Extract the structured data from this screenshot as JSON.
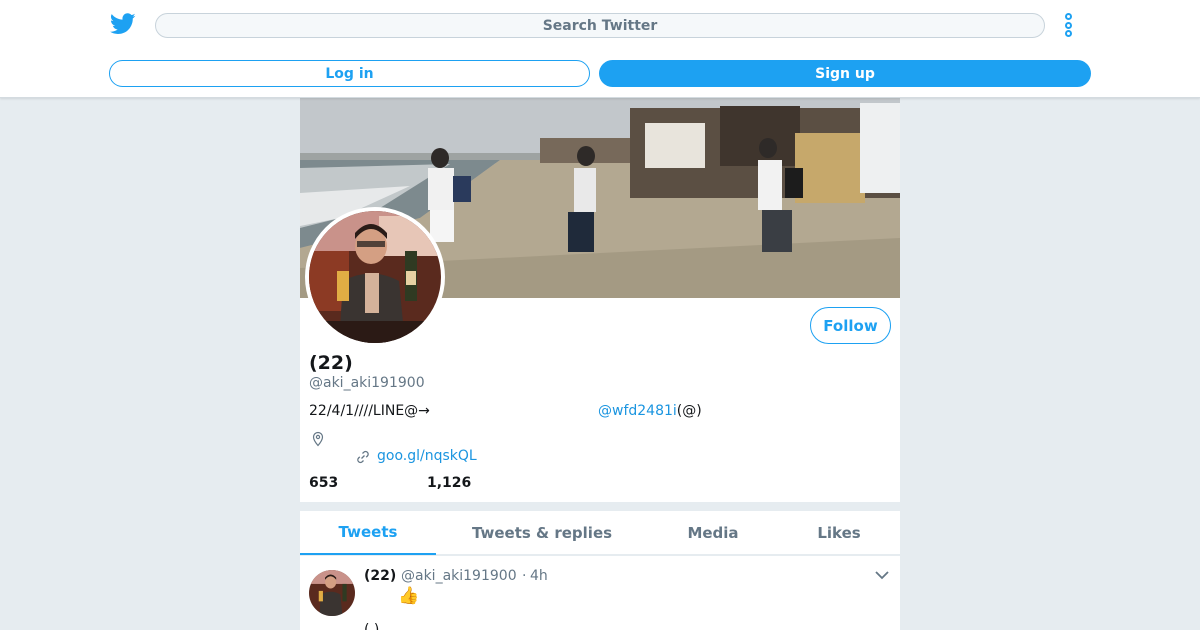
{
  "header": {
    "logo_icon": "twitter-bird-icon",
    "search_placeholder": "Search Twitter",
    "more_icon": "vertical-ellipsis-icon",
    "login_label": "Log in",
    "signup_label": "Sign up"
  },
  "profile": {
    "display_name": "(22)",
    "handle": "@aki_aki191900",
    "bio_text": "22/4/1////LINE@→",
    "bio_mention": "@wfd2481i",
    "bio_suffix": "(@)",
    "location_icon": "map-pin-icon",
    "link_icon": "link-icon",
    "url": "goo.gl/nqskQL",
    "following_count": "653",
    "followers_count": "1,126",
    "follow_label": "Follow"
  },
  "tabs": [
    {
      "label": "Tweets",
      "active": true
    },
    {
      "label": "Tweets & replies",
      "active": false
    },
    {
      "label": "Media",
      "active": false
    },
    {
      "label": "Likes",
      "active": false
    }
  ],
  "tweet": {
    "name": "(22)",
    "handle": "@aki_aki191900",
    "separator": "·",
    "time": "4h",
    "emoji": "👍",
    "more_text": "( )",
    "menu_icon": "chevron-down-icon"
  },
  "colors": {
    "brand": "#1da1f2",
    "link": "#1b95e0",
    "background": "#e6ecf0",
    "muted": "#657786"
  }
}
